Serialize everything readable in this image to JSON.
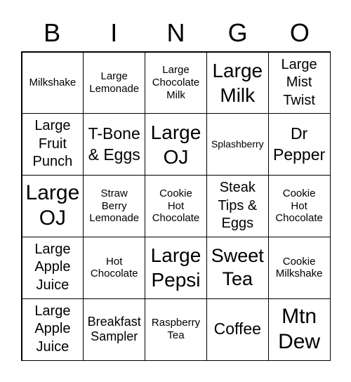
{
  "header": [
    "B",
    "I",
    "N",
    "G",
    "O"
  ],
  "cells": [
    {
      "text": "Milkshake",
      "size": "s15"
    },
    {
      "text": "Large\nLemonade",
      "size": "s15"
    },
    {
      "text": "Large\nChocolate\nMilk",
      "size": "s15"
    },
    {
      "text": "Large\nMilk",
      "size": "s28"
    },
    {
      "text": "Large\nMist\nTwist",
      "size": "s20"
    },
    {
      "text": "Large\nFruit\nPunch",
      "size": "s20"
    },
    {
      "text": "T-Bone\n& Eggs",
      "size": "s22"
    },
    {
      "text": "Large\nOJ",
      "size": "s28"
    },
    {
      "text": "Splashberry",
      "size": "s14"
    },
    {
      "text": "Dr\nPepper",
      "size": "s22"
    },
    {
      "text": "Large\nOJ",
      "size": "s30"
    },
    {
      "text": "Straw\nBerry\nLemonade",
      "size": "s15"
    },
    {
      "text": "Cookie\nHot\nChocolate",
      "size": "s15"
    },
    {
      "text": "Steak\nTips &\nEggs",
      "size": "s20"
    },
    {
      "text": "Cookie\nHot\nChocolate",
      "size": "s15"
    },
    {
      "text": "Large\nApple\nJuice",
      "size": "s20"
    },
    {
      "text": "Hot\nChocolate",
      "size": "s15"
    },
    {
      "text": "Large\nPepsi",
      "size": "s28"
    },
    {
      "text": "Sweet\nTea",
      "size": "s26"
    },
    {
      "text": "Cookie\nMilkshake",
      "size": "s15"
    },
    {
      "text": "Large\nApple\nJuice",
      "size": "s20"
    },
    {
      "text": "Breakfast\nSampler",
      "size": "s17"
    },
    {
      "text": "Raspberry\nTea",
      "size": "s15"
    },
    {
      "text": "Coffee",
      "size": "s22"
    },
    {
      "text": "Mtn\nDew",
      "size": "s30"
    }
  ]
}
